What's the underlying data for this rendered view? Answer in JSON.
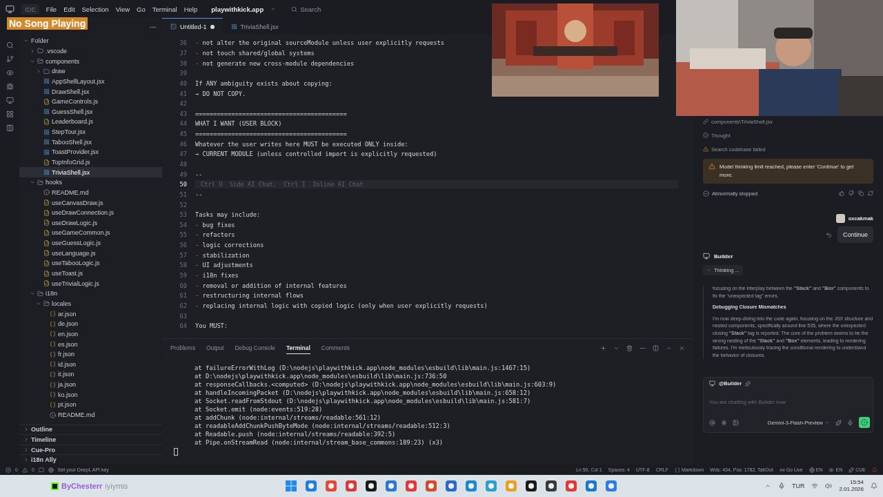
{
  "overlay_label": "No Song Playing",
  "title_bar": {
    "app": "IDE",
    "menus": [
      "File",
      "Edit",
      "Selection",
      "View",
      "Go",
      "Terminal",
      "Help"
    ],
    "project": "playwithkick.app",
    "search": {
      "placeholder": "Search"
    }
  },
  "sidebar": {
    "tree": [
      {
        "label": "Folder",
        "kind": "root",
        "expanded": true,
        "selected": false,
        "children": [
          {
            "label": ".vscode",
            "kind": "folder",
            "expanded": false,
            "selected": false
          },
          {
            "label": "components",
            "kind": "folder",
            "expanded": true,
            "selected": false,
            "children": [
              {
                "label": "draw",
                "kind": "folder",
                "expanded": false,
                "selected": false
              },
              {
                "label": "AppShellLayout.jsx",
                "kind": "jsx",
                "selected": false
              },
              {
                "label": "DrawShell.jsx",
                "kind": "jsx",
                "selected": false
              },
              {
                "label": "GameControls.js",
                "kind": "js",
                "selected": false
              },
              {
                "label": "GuessShell.jsx",
                "kind": "jsx",
                "selected": false
              },
              {
                "label": "Leaderboard.js",
                "kind": "js",
                "selected": false
              },
              {
                "label": "StepTour.jsx",
                "kind": "jsx",
                "selected": false
              },
              {
                "label": "TabooShell.jsx",
                "kind": "jsx",
                "selected": false
              },
              {
                "label": "ToastProvider.jsx",
                "kind": "jsx",
                "selected": false
              },
              {
                "label": "TopInfoGrid.js",
                "kind": "js",
                "selected": false
              },
              {
                "label": "TriviaShell.jsx",
                "kind": "jsx",
                "selected": true
              }
            ]
          },
          {
            "label": "hooks",
            "kind": "folder",
            "expanded": true,
            "selected": false,
            "children": [
              {
                "label": "README.md",
                "kind": "md",
                "selected": false
              },
              {
                "label": "useCanvasDraw.js",
                "kind": "js",
                "selected": false
              },
              {
                "label": "useDrawConnection.js",
                "kind": "js",
                "selected": false
              },
              {
                "label": "useDrawLogic.js",
                "kind": "js",
                "selected": false
              },
              {
                "label": "useGameCommon.js",
                "kind": "js",
                "selected": false
              },
              {
                "label": "useGuessLogic.js",
                "kind": "js",
                "selected": false
              },
              {
                "label": "useLanguage.js",
                "kind": "js",
                "selected": false
              },
              {
                "label": "useTabooLogic.js",
                "kind": "js",
                "selected": false
              },
              {
                "label": "useToast.js",
                "kind": "js",
                "selected": false
              },
              {
                "label": "useTrivialLogic.js",
                "kind": "js",
                "selected": false
              }
            ]
          },
          {
            "label": "i18n",
            "kind": "folder",
            "expanded": true,
            "selected": false,
            "children": [
              {
                "label": "locales",
                "kind": "folder",
                "expanded": true,
                "selected": false,
                "children": [
                  {
                    "label": "ar.json",
                    "kind": "json",
                    "selected": false
                  },
                  {
                    "label": "de.json",
                    "kind": "json",
                    "selected": false
                  },
                  {
                    "label": "en.json",
                    "kind": "json",
                    "selected": false
                  },
                  {
                    "label": "es.json",
                    "kind": "json",
                    "selected": false
                  },
                  {
                    "label": "fr.json",
                    "kind": "json",
                    "selected": false
                  },
                  {
                    "label": "id.json",
                    "kind": "json",
                    "selected": false
                  },
                  {
                    "label": "it.json",
                    "kind": "json",
                    "selected": false
                  },
                  {
                    "label": "ja.json",
                    "kind": "json",
                    "selected": false
                  },
                  {
                    "label": "ko.json",
                    "kind": "json",
                    "selected": false
                  },
                  {
                    "label": "pt.json",
                    "kind": "json",
                    "selected": false
                  },
                  {
                    "label": "README.md",
                    "kind": "md",
                    "selected": false
                  }
                ]
              }
            ]
          }
        ]
      }
    ],
    "sections": [
      "Outline",
      "Timeline",
      "Cue-Pro",
      "i18n Ally"
    ]
  },
  "editor": {
    "tabs": [
      {
        "label": "Untitled-1",
        "selected": true,
        "modified": true
      },
      {
        "label": "TriviaShell.jsx",
        "selected": false,
        "modified": false
      }
    ],
    "lines": [
      {
        "number": "36",
        "marker": "-",
        "text": "not alter the original sourceModule unless user explicitly requests"
      },
      {
        "number": "37",
        "marker": "-",
        "text": "not touch shared/global systems"
      },
      {
        "number": "38",
        "marker": "-",
        "text": "not generate new cross-module dependencies"
      },
      {
        "number": "39"
      },
      {
        "number": "40",
        "text": "If ANY ambiguity exists about copying:"
      },
      {
        "number": "41",
        "text": "→ DO NOT COPY."
      },
      {
        "number": "42"
      },
      {
        "number": "43",
        "text": "=========================================="
      },
      {
        "number": "44",
        "text": "WHAT I WANT (USER BLOCK)"
      },
      {
        "number": "45",
        "text": "=========================================="
      },
      {
        "number": "46",
        "text": "Whatever the user writes here MUST be executed ONLY inside:"
      },
      {
        "number": "47",
        "text": "→ CURRENT MODULE (unless controlled import is explicitly requested)"
      },
      {
        "number": "48"
      },
      {
        "number": "49",
        "text": "--"
      },
      {
        "number": "50",
        "current": true,
        "hint": "Ctrl U  Side AI Chat,  Ctrl I  Inline AI Chat"
      },
      {
        "number": "51",
        "text": "--"
      },
      {
        "number": "52"
      },
      {
        "number": "53",
        "text": "Tasks may include:"
      },
      {
        "number": "54",
        "marker": "-",
        "text": "bug fixes"
      },
      {
        "number": "55",
        "marker": "-",
        "text": "refactors"
      },
      {
        "number": "56",
        "marker": "-",
        "text": "logic corrections"
      },
      {
        "number": "57",
        "marker": "-",
        "text": "stabilization"
      },
      {
        "number": "58",
        "marker": "-",
        "text": "UI adjustments"
      },
      {
        "number": "59",
        "marker": "-",
        "text": "i18n fixes"
      },
      {
        "number": "60",
        "marker": "-",
        "text": "removal or addition of internal features"
      },
      {
        "number": "61",
        "marker": "-",
        "text": "restructuring internal flows"
      },
      {
        "number": "62",
        "marker": "-",
        "text": "replacing internal logic with copied logic (only when user explicitly requests)"
      },
      {
        "number": "63"
      },
      {
        "number": "64",
        "text": "You MUST:"
      }
    ]
  },
  "panel": {
    "tabs": [
      {
        "label": "Problems",
        "selected": false
      },
      {
        "label": "Output",
        "selected": false
      },
      {
        "label": "Debug Console",
        "selected": false
      },
      {
        "label": "Terminal",
        "selected": true
      },
      {
        "label": "Comments",
        "selected": false
      }
    ],
    "terminal_lines": [
      "at failureErrorWithLog (D:\\nodejs\\playwithkick.app\\node_modules\\esbuild\\lib\\main.js:1467:15)",
      "at D:\\nodejs\\playwithkick.app\\node_modules\\esbuild\\lib\\main.js:736:50",
      "at responseCallbacks.<computed> (D:\\nodejs\\playwithkick.app\\node_modules\\esbuild\\lib\\main.js:603:9)",
      "at handleIncomingPacket (D:\\nodejs\\playwithkick.app\\node_modules\\esbuild\\lib\\main.js:658:12)",
      "at Socket.readFromStdout (D:\\nodejs\\playwithkick.app\\node_modules\\esbuild\\lib\\main.js:581:7)",
      "at Socket.emit (node:events:519:28)",
      "at addChunk (node:internal/streams/readable:561:12)",
      "at readableAddChunkPushByteMode (node:internal/streams/readable:512:3)",
      "at Readable.push (node:internal/streams/readable:392:5)",
      "at Pipe.onStreamRead (node:internal/stream_base_commons:189:23) (x3)"
    ]
  },
  "chat": {
    "file": "components\\TriviaShell.jsx",
    "thought": "Thought",
    "search_failed": "Search codebase failed",
    "warning": "Model thinking limit reached, please enter 'Continue' to get more.",
    "stopped": "Abnormally stopped",
    "user": "oxcakmak",
    "user_message": "Continue",
    "agent": "Builder",
    "thinking": {
      "label": "Thinking ...",
      "expanded": true,
      "paragraph_1": "focusing on the interplay between the **\"Stack\"** and **\"Box\"** components to fix the \"unexpected tag\" errors.",
      "heading": "Debugging Closure Mismatches",
      "paragraph_2": "I'm now deep-diving into the code again, focusing on the JSX structure and nested components, specifically around line 535, where the unexpected closing **\"Stack\"** tag is reported. The core of the problem seems to be the wrong nesting of the **\"Stack\"** and **\"Box\"** elements, leading to rendering failures. I'm meticulously tracing the conditional rendering to understand the behavior of closures."
    },
    "input": {
      "mention": "@Builder",
      "placeholder": "You are chatting with Builder now",
      "model": "Gemini-3-Flash-Preview"
    }
  },
  "status_bar": {
    "errors": "0",
    "warnings": "0",
    "deepl": "Set your DeepL API key",
    "right": [
      "Ln 50, Col 1",
      "Spaces: 4",
      "UTF-8",
      "CRLF",
      "Markdown",
      "Wds: 434, Pos: 1782, TabOut",
      "Go Live",
      "EN",
      "EN",
      "CUE"
    ]
  },
  "taskbar": {
    "streamer": "ByChesterr",
    "streamer_note": "iyiymis",
    "language": "TUR",
    "time": "15:54",
    "date": "2.01.2026"
  }
}
